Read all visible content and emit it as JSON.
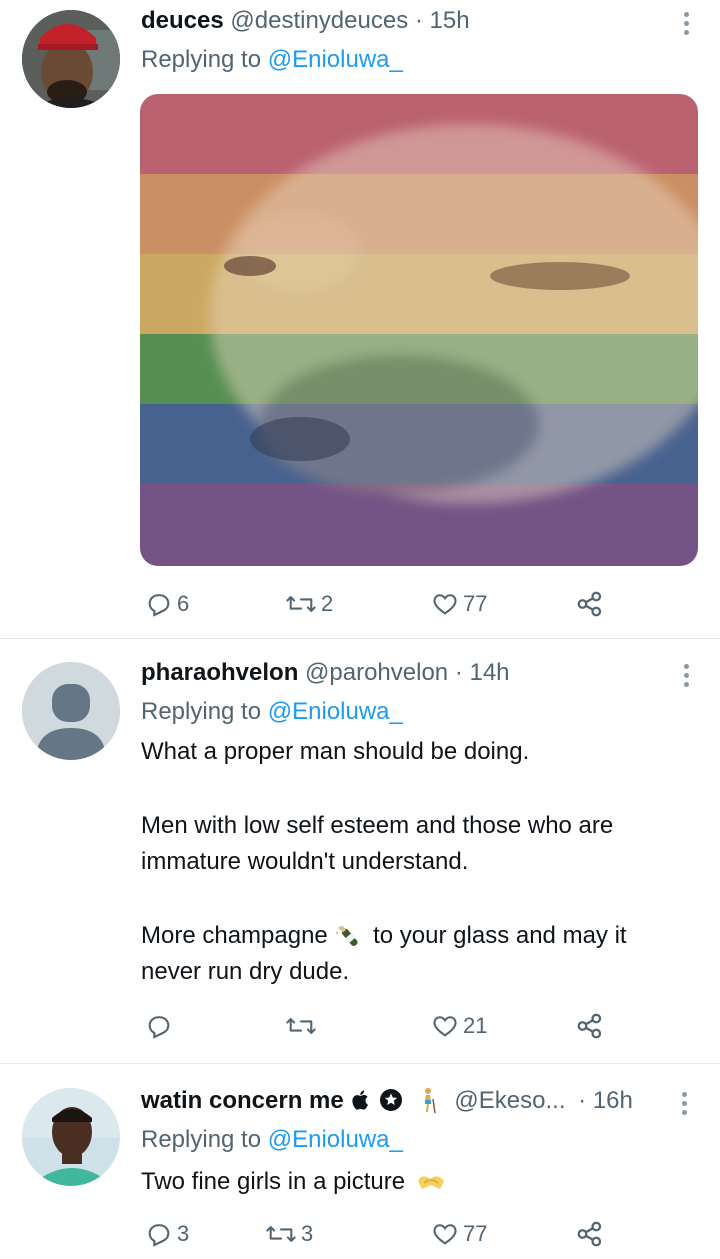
{
  "tweets": [
    {
      "name": "deuces",
      "handle": "@destinydeuces",
      "time": "· 15h",
      "replying_prefix": "Replying to",
      "replying_to": "@Enioluwa_",
      "media_desc_icon": "rainbow-flag-dog-image",
      "actions": {
        "replies": "6",
        "retweets": "2",
        "likes": "77"
      }
    },
    {
      "name": "pharaohvelon",
      "handle": "@parohvelon",
      "time": "· 14h",
      "replying_prefix": "Replying to",
      "replying_to": "@Enioluwa_",
      "text": {
        "line1": "What a proper man should be doing.",
        "line2": "Men with low self esteem and those who are",
        "line3": "immature wouldn't understand.",
        "line4a": "More champagne",
        "line4b": "to your glass and may it",
        "line5": "never run dry dude."
      },
      "actions": {
        "replies": "",
        "retweets": "",
        "likes": "21"
      }
    },
    {
      "name": "watin concern me",
      "handle": "@Ekeso...",
      "time": "· 16h",
      "replying_prefix": "Replying to",
      "replying_to": "@Enioluwa_",
      "text": "Two fine girls in a picture",
      "actions": {
        "replies": "3",
        "retweets": "3",
        "likes": "77"
      }
    }
  ],
  "colors": {
    "text": "#0f1419",
    "secondary": "#536471",
    "link": "#1d9bf0",
    "divider": "#e7e9ec"
  }
}
